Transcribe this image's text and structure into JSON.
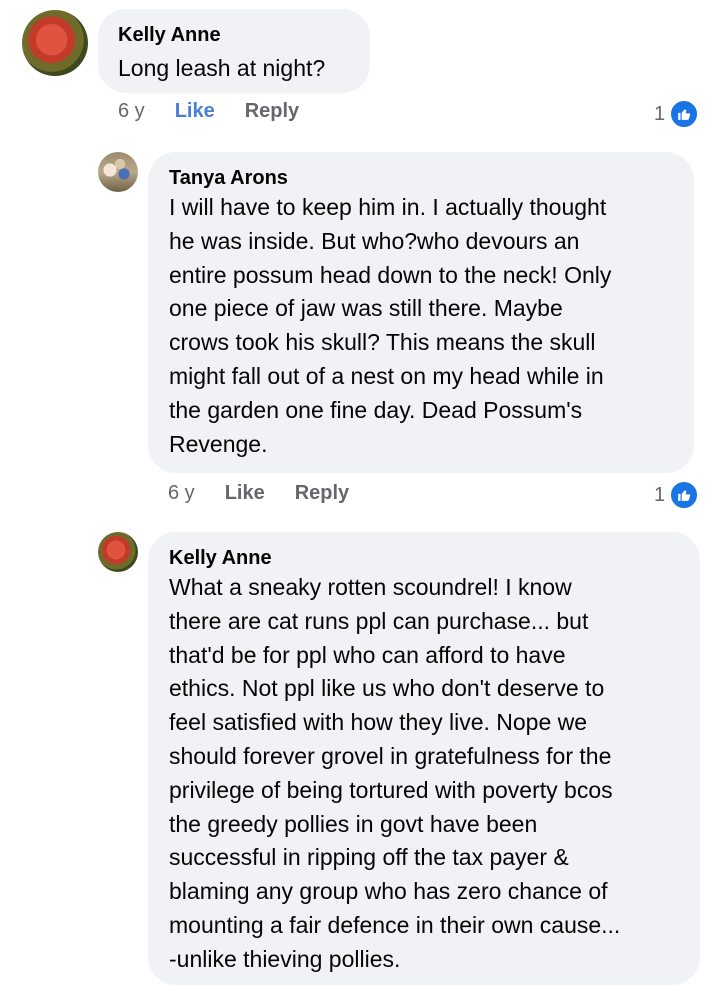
{
  "comments": [
    {
      "author": "Kelly Anne",
      "text": "Long leash at night?",
      "time": "6 y",
      "like_label": "Like",
      "reply_label": "Reply",
      "reaction_count": "1"
    },
    {
      "author": "Tanya Arons",
      "text": "I will have to keep him in.  I actually thought\nhe was inside.  But who?who devours an\nentire possum head down to the neck!  Only\none piece of jaw was still there.  Maybe\ncrows took his skull? This means the skull\nmight fall out of a nest on my head while in\nthe garden one fine day.  Dead Possum's\nRevenge.",
      "time": "6 y",
      "like_label": "Like",
      "reply_label": "Reply",
      "reaction_count": "1"
    },
    {
      "author": "Kelly Anne",
      "text": "What a sneaky rotten scoundrel! I know\nthere are cat runs ppl can purchase... but\nthat'd be for ppl who can afford to have\nethics. Not ppl like us who don't deserve to\nfeel satisfied with how they live. Nope we\nshould forever grovel in gratefulness for the\nprivilege of being tortured with poverty bcos\nthe greedy pollies in govt have been\nsuccessful in ripping off the tax payer &\nblaming any group who has zero chance of\nmounting a fair defence in their own cause...\n-unlike thieving pollies."
    }
  ],
  "colors": {
    "bubble": "#f0f2f5",
    "like_active": "#4b7fd1",
    "reaction_badge": "#1b74e4",
    "meta_text": "#65676b"
  },
  "icons": {
    "reaction": "thumbs-up-icon"
  }
}
